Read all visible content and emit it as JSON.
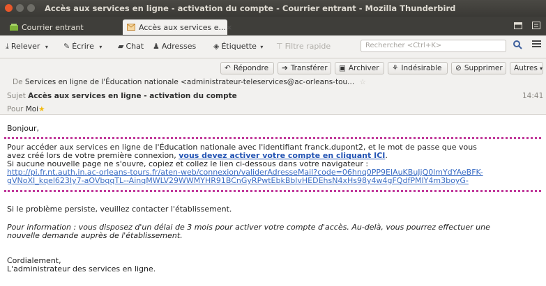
{
  "window": {
    "title": "Accès aux services en ligne - activation du compte - Courrier entrant - Mozilla Thunderbird"
  },
  "tabs": [
    {
      "label": "Courrier entrant",
      "icon": "inbox-folder-icon"
    },
    {
      "label": "Accès aux services e...",
      "icon": "mail-icon",
      "close": "×"
    }
  ],
  "toolbar": {
    "get": "Relever",
    "write": "Écrire",
    "chat": "Chat",
    "address": "Adresses",
    "tag": "Étiquette",
    "filter": "Filtre rapide",
    "search_placeholder": "Rechercher <Ctrl+K>"
  },
  "header": {
    "actions": {
      "reply": "Répondre",
      "forward": "Transférer",
      "archive": "Archiver",
      "junk": "Indésirable",
      "delete": "Supprimer",
      "other": "Autres"
    },
    "from_label": "De",
    "from_value": "Services en ligne de l'Éducation nationale <administrateur-teleservices@ac-orleans-tou...",
    "subject_label": "Sujet",
    "subject_value": "Accès aux services en ligne - activation du compte",
    "time": "14:41",
    "to_label": "Pour",
    "to_value": "Moi"
  },
  "body": {
    "greeting": "Bonjour,",
    "p1_a": "Pour accéder aux services en ligne de l'Éducation nationale avec l'identifiant franck.dupont2, et le mot de passe que vous",
    "p1_b": "avez créé lors de votre première connexion,",
    "p1_link": "vous devez activer votre compte en cliquant ICI",
    "p1_end": ".",
    "p2": "Si aucune nouvelle page ne s'ouvre, copiez et collez le lien ci-dessous dans votre navigateur :",
    "url_line1": "http://pi.fr.nt.auth.in.ac-orleans-tours.fr/aten-web/connexion/validerAdresseMail?code=06hnq0PP9ElAuKBuJjQ0lmYdYAeBFK-",
    "url_line2": "gVNoXI_kqel623Iy7-aOVbqqTL--AinqMWLV29WWMYHR91BCnGyRPwtEbkBblvHEDEhsN4xHs98y4w4gFQdfPMIY4m3boyG-",
    "p3": "Si le problème persiste, veuillez contacter l'établissement.",
    "p4_a": "Pour information : vous disposez d'un délai de 3 mois pour activer votre compte d'accès. Au-delà, vous pourrez effectuer une",
    "p4_b": "nouvelle demande auprès de l'établissement.",
    "closing1": "Cordialement,",
    "closing2": "L'administrateur des services en ligne."
  },
  "colors": {
    "titlebar": "#3f3e3a",
    "close_button": "#e9582b",
    "link": "#2454b3",
    "dotted_border": "#c0399a"
  }
}
